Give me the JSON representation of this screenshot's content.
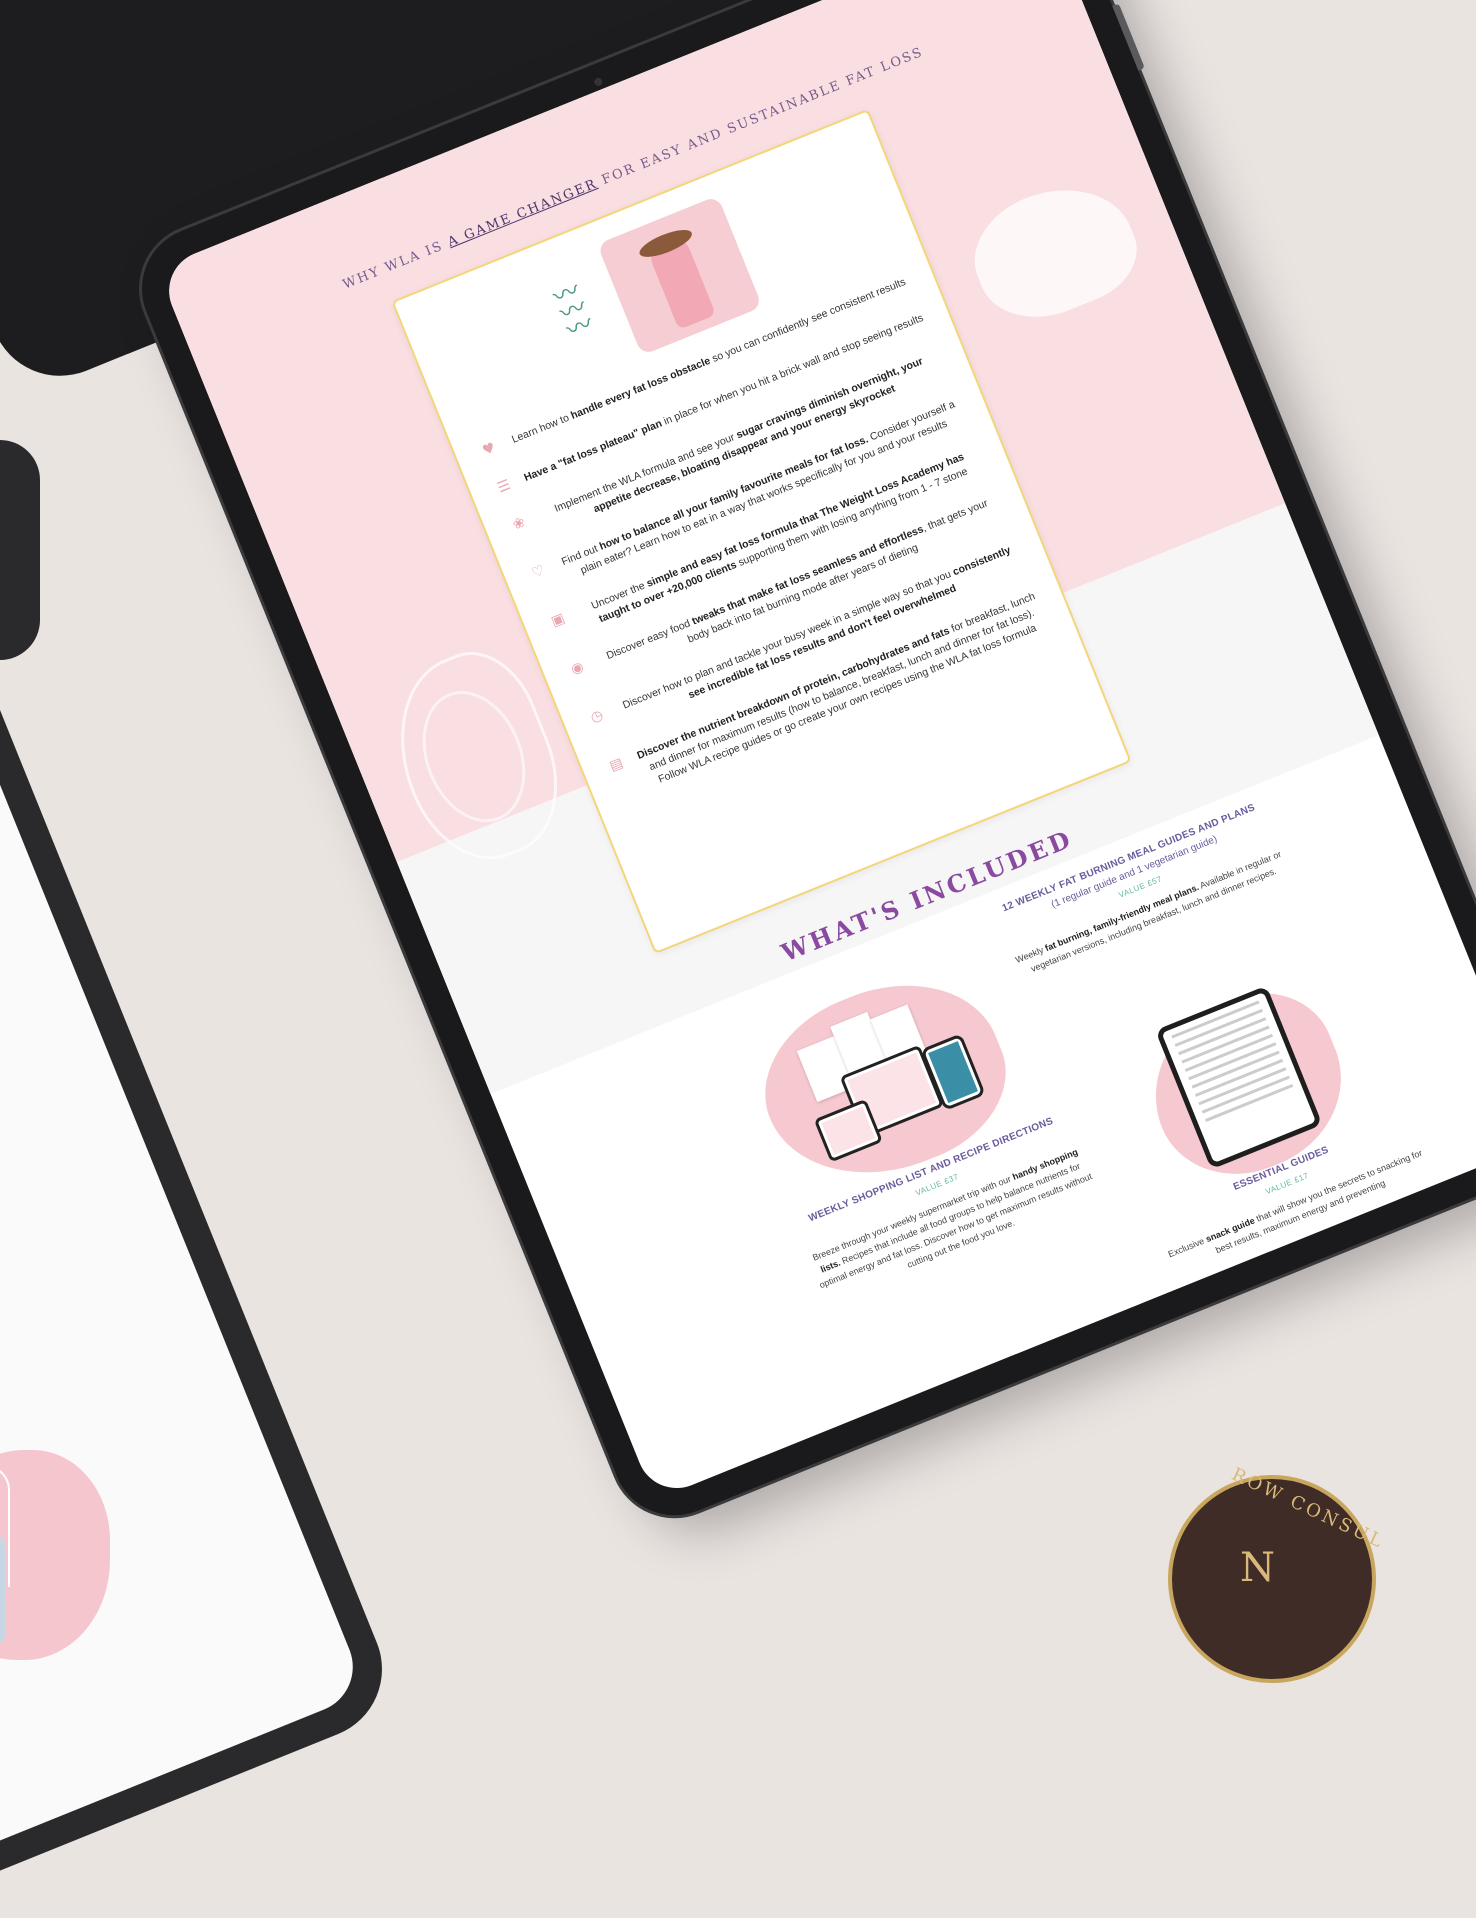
{
  "headline": {
    "prefix": "WHY WLA IS",
    "highlight": "A GAME CHANGER",
    "suffix": "FOR EASY AND SUSTAINABLE FAT LOSS"
  },
  "benefits": [
    {
      "icon": "dumbbell-icon",
      "pre": "Learn how to ",
      "bold": "handle every fat loss obstacle",
      "post": " so you can confidently see consistent results"
    },
    {
      "icon": "scale-icon",
      "pre": "",
      "bold": "Have a \"fat loss plateau\" plan",
      "post": " in place for when you hit a brick wall and stop seeing results"
    },
    {
      "icon": "leaf-icon",
      "pre": "Implement the WLA formula and see your ",
      "bold": "sugar cravings diminish overnight, your appetite decrease, bloating disappear and your energy skyrocket",
      "post": ""
    },
    {
      "icon": "heart-icon",
      "pre": "Find out ",
      "bold": "how to balance all your family favourite meals for fat loss.",
      "post": " Consider yourself a plain eater? Learn how to eat in a way that works specifically for you and your results"
    },
    {
      "icon": "formula-icon",
      "pre": "Uncover the ",
      "bold": "simple and easy fat loss formula that The Weight Loss Academy has taught to over +20,000 clients",
      "post": " supporting them with losing anything from 1 - 7 stone"
    },
    {
      "icon": "apple-icon",
      "pre": "Discover easy food ",
      "bold": "tweaks that make fat loss seamless and effortless",
      "post": ", that gets your body back into fat burning mode after years of dieting"
    },
    {
      "icon": "clock-icon",
      "pre": "Discover how to plan and tackle your busy week in a simple way so that you ",
      "bold": "consistently see incredible fat loss results and don't feel overwhelmed",
      "post": ""
    },
    {
      "icon": "plate-icon",
      "pre": "",
      "bold": "Discover the nutrient breakdown of protein, carbohydrates and fats",
      "post": " for breakfast, lunch and dinner for maximum results (how to balance, breakfast, lunch and dinner for fat loss). Follow WLA recipe guides or go create your own recipes using the WLA fat loss formula"
    }
  ],
  "included": {
    "title": "WHAT'S INCLUDED",
    "features": [
      {
        "title": "12 WEEKLY FAT BURNING MEAL GUIDES AND PLANS",
        "subtitle": "(1 regular guide and 1 vegetarian guide)",
        "value": "VALUE £57",
        "desc_pre": "Weekly ",
        "desc_bold": "fat burning, family-friendly meal plans.",
        "desc_post": " Available in regular or vegetarian versions, including breakfast, lunch and dinner recipes."
      },
      {
        "title": "WEEKLY SHOPPING LIST AND RECIPE DIRECTIONS",
        "subtitle": "",
        "value": "VALUE £37",
        "desc_pre": "Breeze through your weekly supermarket trip with our ",
        "desc_bold": "handy shopping lists.",
        "desc_post": " Recipes that include all food groups to help balance nutrients for optimal energy and fat loss. Discover how to get maximum results without cutting out the food you love."
      },
      {
        "title": "ESSENTIAL GUIDES",
        "subtitle": "",
        "value": "VALUE £17",
        "desc_pre": "Exclusive ",
        "desc_bold": "snack guide",
        "desc_post": " that will show you the secrets to snacking for best results, maximum energy and preventing"
      }
    ]
  },
  "logo": {
    "text": "ROW CONSUL",
    "monogram": "N"
  },
  "colors": {
    "pink": "#f9dee2",
    "accent_purple": "#8a4aa0",
    "value_green": "#5fb79a",
    "card_border": "#f3d67a"
  }
}
